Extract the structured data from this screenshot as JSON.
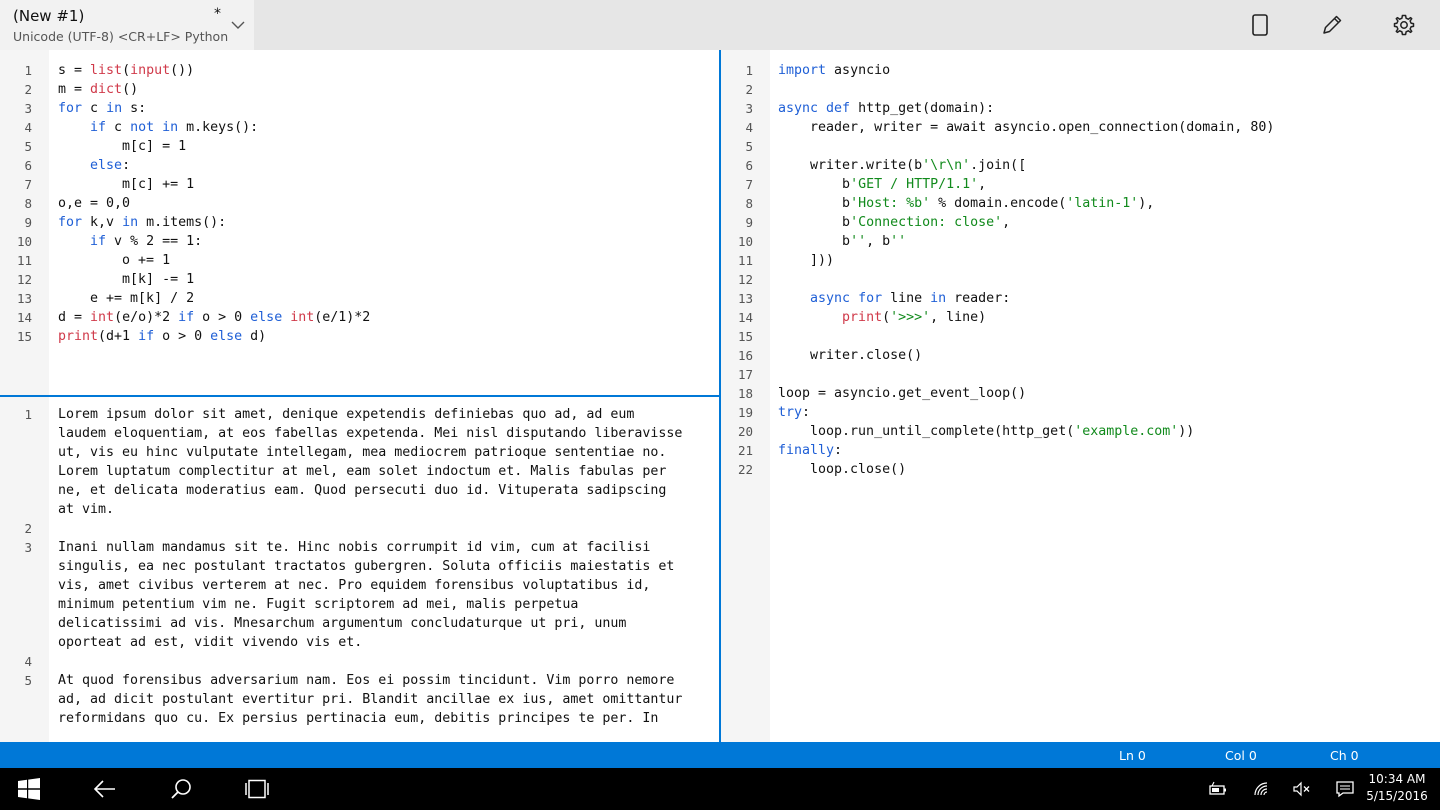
{
  "header": {
    "tab_title": "(New #1)",
    "tab_dirty": "*",
    "tab_subtitle": "Unicode (UTF-8) <CR+LF> Python",
    "icons": [
      "tablet-mode-icon",
      "edit-pencil-icon",
      "settings-gear-icon"
    ]
  },
  "left_top": {
    "line_numbers": [
      "1",
      "2",
      "3",
      "4",
      "5",
      "6",
      "7",
      "8",
      "9",
      "10",
      "11",
      "12",
      "13",
      "14",
      "15"
    ],
    "lines": [
      [
        {
          "t": "s = ",
          "c": "code"
        },
        {
          "t": "list",
          "c": "bi"
        },
        {
          "t": "(",
          "c": "code"
        },
        {
          "t": "input",
          "c": "bi"
        },
        {
          "t": "())",
          "c": "code"
        }
      ],
      [
        {
          "t": "m = ",
          "c": "code"
        },
        {
          "t": "dict",
          "c": "bi"
        },
        {
          "t": "()",
          "c": "code"
        }
      ],
      [
        {
          "t": "for",
          "c": "kw"
        },
        {
          "t": " c ",
          "c": "code"
        },
        {
          "t": "in",
          "c": "kw"
        },
        {
          "t": " s:",
          "c": "code"
        }
      ],
      [
        {
          "t": "    ",
          "c": "code"
        },
        {
          "t": "if",
          "c": "kw"
        },
        {
          "t": " c ",
          "c": "code"
        },
        {
          "t": "not in",
          "c": "kw"
        },
        {
          "t": " m.keys():",
          "c": "code"
        }
      ],
      [
        {
          "t": "        m[c] = 1",
          "c": "code"
        }
      ],
      [
        {
          "t": "    ",
          "c": "code"
        },
        {
          "t": "else",
          "c": "kw"
        },
        {
          "t": ":",
          "c": "code"
        }
      ],
      [
        {
          "t": "        m[c] += 1",
          "c": "code"
        }
      ],
      [
        {
          "t": "o,e = 0,0",
          "c": "code"
        }
      ],
      [
        {
          "t": "for",
          "c": "kw"
        },
        {
          "t": " k,v ",
          "c": "code"
        },
        {
          "t": "in",
          "c": "kw"
        },
        {
          "t": " m.items():",
          "c": "code"
        }
      ],
      [
        {
          "t": "    ",
          "c": "code"
        },
        {
          "t": "if",
          "c": "kw"
        },
        {
          "t": " v % 2 == 1:",
          "c": "code"
        }
      ],
      [
        {
          "t": "        o += 1",
          "c": "code"
        }
      ],
      [
        {
          "t": "        m[k] -= 1",
          "c": "code"
        }
      ],
      [
        {
          "t": "    e += m[k] / 2",
          "c": "code"
        }
      ],
      [
        {
          "t": "d = ",
          "c": "code"
        },
        {
          "t": "int",
          "c": "bi"
        },
        {
          "t": "(e/o)*2 ",
          "c": "code"
        },
        {
          "t": "if",
          "c": "kw"
        },
        {
          "t": " o > 0 ",
          "c": "code"
        },
        {
          "t": "else",
          "c": "kw"
        },
        {
          "t": " ",
          "c": "code"
        },
        {
          "t": "int",
          "c": "bi"
        },
        {
          "t": "(e/1)*2",
          "c": "code"
        }
      ],
      [
        {
          "t": "print",
          "c": "bi"
        },
        {
          "t": "(d+1 ",
          "c": "code"
        },
        {
          "t": "if",
          "c": "kw"
        },
        {
          "t": " o > 0 ",
          "c": "code"
        },
        {
          "t": "else",
          "c": "kw"
        },
        {
          "t": " d)",
          "c": "code"
        }
      ]
    ]
  },
  "left_bottom": {
    "paragraphs": [
      {
        "num": "1",
        "lines": [
          "Lorem ipsum dolor sit amet, denique expetendis definiebas quo ad, ad eum",
          "laudem eloquentiam, at eos fabellas expetenda. Mei nisl disputando liberavisse",
          "ut, vis eu hinc vulputate intellegam, mea mediocrem patrioque sententiae no.",
          "Lorem luptatum complectitur at mel, eam solet indoctum et. Malis fabulas per",
          "ne, et delicata moderatius eam. Quod persecuti duo id. Vituperata sadipscing",
          "at vim."
        ]
      },
      {
        "num": "2",
        "lines": [
          ""
        ]
      },
      {
        "num": "3",
        "lines": [
          "Inani nullam mandamus sit te. Hinc nobis corrumpit id vim, cum at facilisi",
          "singulis, ea nec postulant tractatos gubergren. Soluta officiis maiestatis et",
          "vis, amet civibus verterem at nec. Pro equidem forensibus voluptatibus id,",
          "minimum petentium vim ne. Fugit scriptorem ad mei, malis perpetua",
          "delicatissimi ad vis. Mnesarchum argumentum concludaturque ut pri, unum",
          "oporteat ad est, vidit vivendo vis et."
        ]
      },
      {
        "num": "4",
        "lines": [
          ""
        ]
      },
      {
        "num": "5",
        "lines": [
          "At quod forensibus adversarium nam. Eos ei possim tincidunt. Vim porro nemore",
          "ad, ad dicit postulant evertitur pri. Blandit ancillae ex ius, amet omittantur",
          "reformidans quo cu. Ex persius pertinacia eum, debitis principes te per. In"
        ]
      }
    ]
  },
  "right": {
    "line_numbers": [
      "1",
      "2",
      "3",
      "4",
      "5",
      "6",
      "7",
      "8",
      "9",
      "10",
      "11",
      "12",
      "13",
      "14",
      "15",
      "16",
      "17",
      "18",
      "19",
      "20",
      "21",
      "22"
    ],
    "lines": [
      [
        {
          "t": "import",
          "c": "kw"
        },
        {
          "t": " asyncio",
          "c": "code"
        }
      ],
      [],
      [
        {
          "t": "async def",
          "c": "kw"
        },
        {
          "t": " http_get(domain):",
          "c": "code"
        }
      ],
      [
        {
          "t": "    reader, writer = await asyncio.open_connection(domain, 80)",
          "c": "code"
        }
      ],
      [],
      [
        {
          "t": "    writer.write(b",
          "c": "code"
        },
        {
          "t": "'\\r\\n'",
          "c": "str"
        },
        {
          "t": ".join([",
          "c": "code"
        }
      ],
      [
        {
          "t": "        b",
          "c": "code"
        },
        {
          "t": "'GET / HTTP/1.1'",
          "c": "str"
        },
        {
          "t": ",",
          "c": "code"
        }
      ],
      [
        {
          "t": "        b",
          "c": "code"
        },
        {
          "t": "'Host: %b'",
          "c": "str"
        },
        {
          "t": " % domain.encode(",
          "c": "code"
        },
        {
          "t": "'latin-1'",
          "c": "str"
        },
        {
          "t": "),",
          "c": "code"
        }
      ],
      [
        {
          "t": "        b",
          "c": "code"
        },
        {
          "t": "'Connection: close'",
          "c": "str"
        },
        {
          "t": ",",
          "c": "code"
        }
      ],
      [
        {
          "t": "        b",
          "c": "code"
        },
        {
          "t": "''",
          "c": "str"
        },
        {
          "t": ", b",
          "c": "code"
        },
        {
          "t": "''",
          "c": "str"
        }
      ],
      [
        {
          "t": "    ]))",
          "c": "code"
        }
      ],
      [],
      [
        {
          "t": "    ",
          "c": "code"
        },
        {
          "t": "async for",
          "c": "kw"
        },
        {
          "t": " line ",
          "c": "code"
        },
        {
          "t": "in",
          "c": "kw"
        },
        {
          "t": " reader:",
          "c": "code"
        }
      ],
      [
        {
          "t": "        ",
          "c": "code"
        },
        {
          "t": "print",
          "c": "bi"
        },
        {
          "t": "(",
          "c": "code"
        },
        {
          "t": "'>>>'",
          "c": "str"
        },
        {
          "t": ", line)",
          "c": "code"
        }
      ],
      [],
      [
        {
          "t": "    writer.close()",
          "c": "code"
        }
      ],
      [],
      [
        {
          "t": "loop = asyncio.get_event_loop()",
          "c": "code"
        }
      ],
      [
        {
          "t": "try",
          "c": "kw"
        },
        {
          "t": ":",
          "c": "code"
        }
      ],
      [
        {
          "t": "    loop.run_until_complete(http_get(",
          "c": "code"
        },
        {
          "t": "'example.com'",
          "c": "str"
        },
        {
          "t": "))",
          "c": "code"
        }
      ],
      [
        {
          "t": "finally",
          "c": "kw"
        },
        {
          "t": ":",
          "c": "code"
        }
      ],
      [
        {
          "t": "    loop.close()",
          "c": "code"
        }
      ]
    ]
  },
  "status": {
    "ln": "Ln 0",
    "col": "Col 0",
    "ch": "Ch 0"
  },
  "taskbar": {
    "time": "10:34 AM",
    "date": "5/15/2016",
    "icons": [
      "windows-start-icon",
      "back-arrow-icon",
      "search-icon",
      "task-view-icon",
      "battery-charging-icon",
      "wifi-icon",
      "volume-muted-icon",
      "action-center-icon"
    ]
  },
  "colors": {
    "accent": "#0078d7",
    "keyword": "#1f5fd6",
    "builtin": "#d03a4a",
    "string": "#118a1c"
  }
}
